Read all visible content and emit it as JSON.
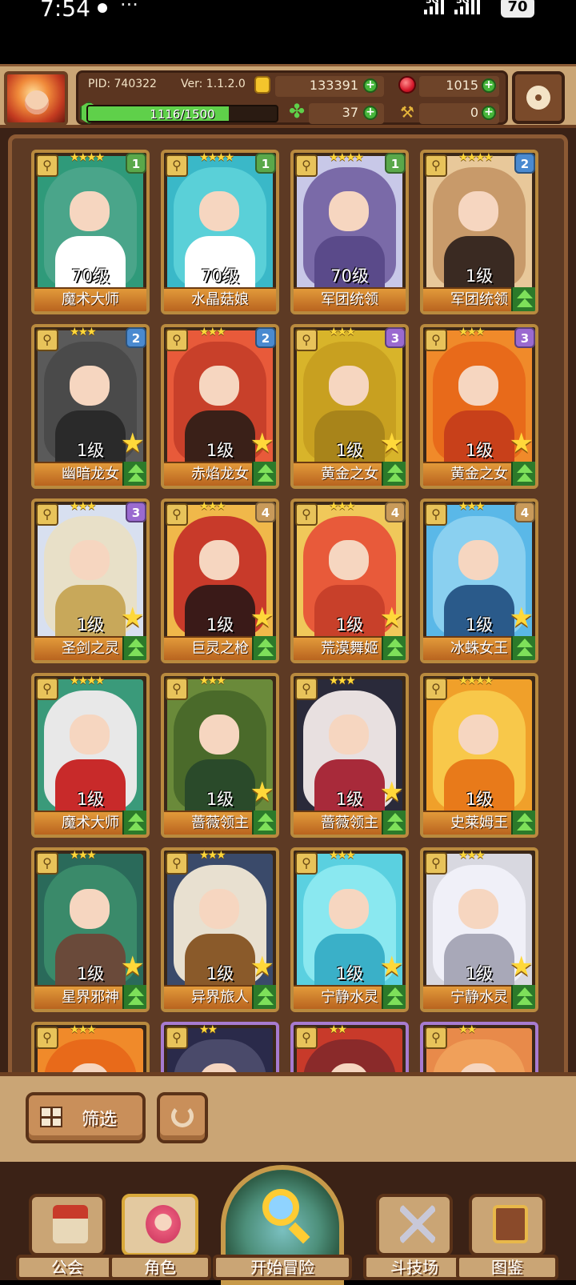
{
  "status_bar": {
    "time": "7:54",
    "net1": "5G",
    "net2": "5G",
    "battery": "70"
  },
  "header": {
    "pid": "PID: 740322",
    "version": "Ver: 1.1.2.0",
    "gold": "133391",
    "gems": "1015",
    "clover": "37",
    "hammer": "0",
    "xp_text": "1116/1500",
    "xp_fraction": 0.744
  },
  "cards": [
    {
      "name": "魔术大师",
      "level": "70级",
      "badge": "1",
      "stars": "★★★★",
      "upgrade": false,
      "star": false,
      "colors": [
        "#2f9a7a",
        "#ffffff",
        "#4aa58a"
      ]
    },
    {
      "name": "水晶菇娘",
      "level": "70级",
      "badge": "1",
      "stars": "★★★★",
      "upgrade": false,
      "star": false,
      "colors": [
        "#3ab8c8",
        "#ffffff",
        "#5ad0d8"
      ]
    },
    {
      "name": "军团统领",
      "level": "70级",
      "badge": "1",
      "stars": "★★★★",
      "upgrade": false,
      "star": false,
      "colors": [
        "#c8c8e8",
        "#5a4a8a",
        "#7a6aa8"
      ]
    },
    {
      "name": "军团统领",
      "level": "1级",
      "badge": "2",
      "stars": "★★★★",
      "upgrade": true,
      "star": false,
      "colors": [
        "#e8c89a",
        "#3a2a22",
        "#c89a6a"
      ]
    },
    {
      "name": "幽暗龙女",
      "level": "1级",
      "badge": "2",
      "stars": "★★★",
      "upgrade": true,
      "star": true,
      "colors": [
        "#5a5a5a",
        "#2a2a2a",
        "#4a4a4a"
      ]
    },
    {
      "name": "赤焰龙女",
      "level": "1级",
      "badge": "2",
      "stars": "★★★",
      "upgrade": true,
      "star": true,
      "colors": [
        "#e85a3a",
        "#3a2018",
        "#c8402a"
      ]
    },
    {
      "name": "黄金之女",
      "level": "1级",
      "badge": "3",
      "stars": "★★★",
      "upgrade": true,
      "star": true,
      "colors": [
        "#d8b42a",
        "#a8841a",
        "#c8a020"
      ]
    },
    {
      "name": "黄金之女",
      "level": "1级",
      "badge": "3",
      "stars": "★★★",
      "upgrade": true,
      "star": true,
      "colors": [
        "#f08a2a",
        "#c8401a",
        "#e86a1a"
      ]
    },
    {
      "name": "圣剑之灵",
      "level": "1级",
      "badge": "3",
      "stars": "★★★",
      "upgrade": true,
      "star": true,
      "colors": [
        "#d8e0f0",
        "#c8a85a",
        "#e8e0c8"
      ]
    },
    {
      "name": "巨灵之枪",
      "level": "1级",
      "badge": "4",
      "stars": "★★★",
      "upgrade": true,
      "star": true,
      "colors": [
        "#f0b84a",
        "#3a1a18",
        "#c83a2a"
      ]
    },
    {
      "name": "荒漠舞姬",
      "level": "1级",
      "badge": "4",
      "stars": "★★★",
      "upgrade": true,
      "star": true,
      "colors": [
        "#f0c85a",
        "#c8402a",
        "#e85a3a"
      ]
    },
    {
      "name": "冰蛛女王",
      "level": "1级",
      "badge": "4",
      "stars": "★★★",
      "upgrade": true,
      "star": true,
      "colors": [
        "#5ab8e8",
        "#2a5a8a",
        "#8ad0f0"
      ]
    },
    {
      "name": "魔术大师",
      "level": "1级",
      "badge": "",
      "stars": "★★★★",
      "upgrade": true,
      "star": false,
      "colors": [
        "#3a9a7a",
        "#c82a2a",
        "#e8e8e8"
      ]
    },
    {
      "name": "蔷薇领主",
      "level": "1级",
      "badge": "",
      "stars": "★★★",
      "upgrade": true,
      "star": true,
      "colors": [
        "#6a8a3a",
        "#2a4a2a",
        "#4a6a2a"
      ]
    },
    {
      "name": "蔷薇领主",
      "level": "1级",
      "badge": "",
      "stars": "★★★",
      "upgrade": true,
      "star": true,
      "colors": [
        "#2a2a3a",
        "#a82a3a",
        "#e8e0e0"
      ]
    },
    {
      "name": "史莱姆王",
      "level": "1级",
      "badge": "",
      "stars": "★★★★",
      "upgrade": true,
      "star": false,
      "colors": [
        "#f0a02a",
        "#e87a1a",
        "#f8c84a"
      ]
    },
    {
      "name": "星界邪神",
      "level": "1级",
      "badge": "",
      "stars": "★★★",
      "upgrade": true,
      "star": true,
      "colors": [
        "#2a6a5a",
        "#6a4a3a",
        "#3a8a6a"
      ]
    },
    {
      "name": "异界旅人",
      "level": "1级",
      "badge": "",
      "stars": "★★★",
      "upgrade": true,
      "star": true,
      "colors": [
        "#3a4a6a",
        "#8a5a2a",
        "#e8e0d0"
      ]
    },
    {
      "name": "宁静水灵",
      "level": "1级",
      "badge": "",
      "stars": "★★★",
      "upgrade": true,
      "star": true,
      "colors": [
        "#5ad0e0",
        "#3ab0c8",
        "#8ae8f0"
      ]
    },
    {
      "name": "宁静水灵",
      "level": "1级",
      "badge": "",
      "stars": "★★★",
      "upgrade": true,
      "star": true,
      "colors": [
        "#d8d8e0",
        "#a8a8b8",
        "#f0f0f8"
      ]
    },
    {
      "name": "",
      "level": "",
      "badge": "",
      "stars": "★★★",
      "upgrade": false,
      "star": false,
      "colors": [
        "#f08a2a",
        "#c8401a",
        "#e86a1a"
      ]
    },
    {
      "name": "",
      "level": "",
      "badge": "",
      "stars": "★★",
      "upgrade": false,
      "star": false,
      "colors": [
        "#2a2a4a",
        "#3a3a5a",
        "#4a4a6a"
      ]
    },
    {
      "name": "",
      "level": "",
      "badge": "",
      "stars": "★★",
      "upgrade": false,
      "star": false,
      "colors": [
        "#c83a2a",
        "#3a2a2a",
        "#8a2a2a"
      ]
    },
    {
      "name": "",
      "level": "",
      "badge": "",
      "stars": "★★",
      "upgrade": false,
      "star": false,
      "colors": [
        "#e88a4a",
        "#c86a2a",
        "#f0a05a"
      ]
    }
  ],
  "filter": {
    "label": "筛选"
  },
  "nav": {
    "guild": "公会",
    "character": "角色",
    "adventure": "开始冒险",
    "arena": "斗技场",
    "codex": "图鉴"
  }
}
